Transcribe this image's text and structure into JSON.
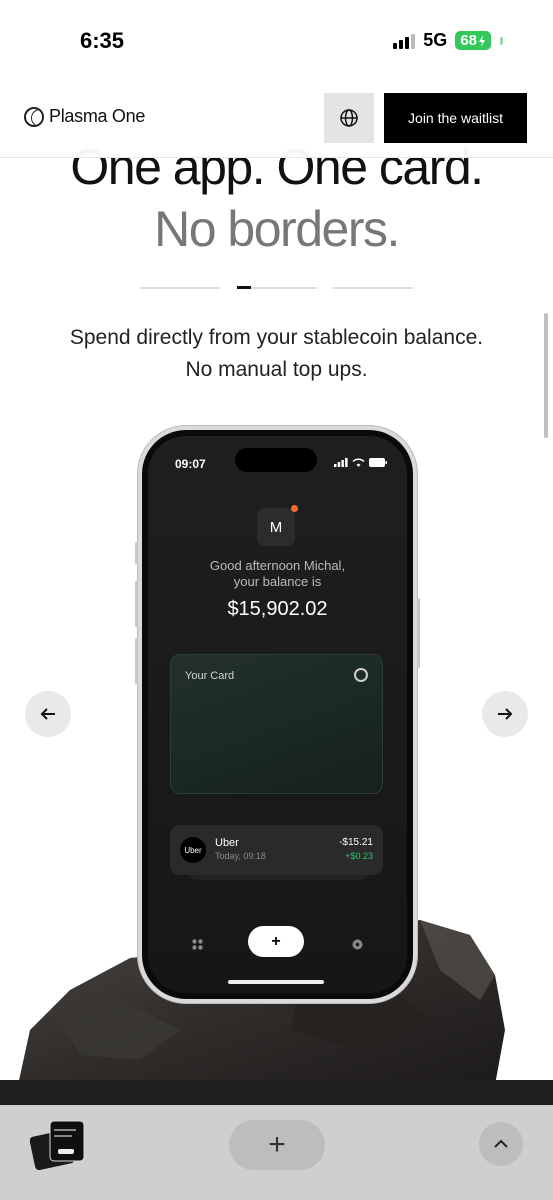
{
  "status_bar": {
    "time": "6:35",
    "network": "5G",
    "battery": "68"
  },
  "header": {
    "logo_text": "Plasma One",
    "waitlist_label": "Join the waitlist",
    "globe_icon": "globe-icon"
  },
  "hero": {
    "line1": "One app. One card.",
    "line2": "No borders.",
    "subtitle": "Spend directly from your stablecoin balance. No manual top ups.",
    "progress_active_index": 1,
    "progress_count": 3
  },
  "phone": {
    "time": "09:07",
    "avatar_initial": "M",
    "greeting": "Good afternoon Michal, your balance is",
    "balance": "$15,902.02",
    "card_label": "Your Card",
    "transaction": {
      "logo": "Uber",
      "name": "Uber",
      "time": "Today, 09:18",
      "amount": "-$15.21",
      "cashback": "+$0.23"
    },
    "tab_plus": "+"
  },
  "carousel": {
    "prev_icon": "arrow-left-icon",
    "next_icon": "arrow-right-icon"
  },
  "browser_bar": {
    "new_tab_label": "+",
    "up_icon": "chevron-up-icon"
  },
  "colors": {
    "accent_dot": "#ff6a2b",
    "cashback": "#31c16b",
    "battery": "#34c759"
  }
}
